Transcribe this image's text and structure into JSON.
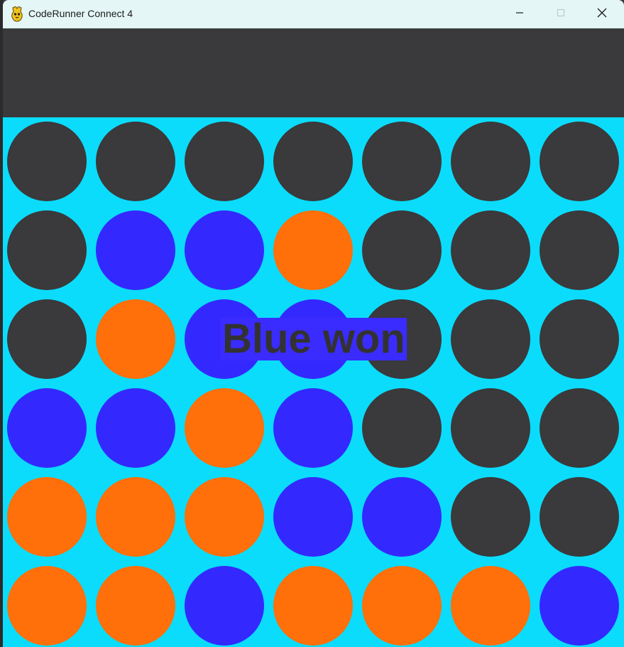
{
  "window": {
    "title": "CodeRunner Connect 4",
    "icon": "python-icon",
    "controls": [
      "minimize-icon",
      "maximize-icon",
      "close-icon"
    ]
  },
  "game": {
    "result_text": "Blue won",
    "rows": 6,
    "columns": 7,
    "grid": [
      [
        "empty",
        "empty",
        "empty",
        "empty",
        "empty",
        "empty",
        "empty"
      ],
      [
        "empty",
        "blue",
        "blue",
        "orange",
        "empty",
        "empty",
        "empty"
      ],
      [
        "empty",
        "orange",
        "blue",
        "blue",
        "empty",
        "empty",
        "empty"
      ],
      [
        "blue",
        "blue",
        "orange",
        "blue",
        "empty",
        "empty",
        "empty"
      ],
      [
        "orange",
        "orange",
        "orange",
        "blue",
        "blue",
        "empty",
        "empty"
      ],
      [
        "orange",
        "orange",
        "blue",
        "orange",
        "orange",
        "orange",
        "blue"
      ]
    ]
  },
  "colors": {
    "board": "#0bdcfc",
    "empty": "#3a393b",
    "blue": "#3329ff",
    "orange": "#ff6f0a",
    "header": "#3a393b",
    "label_bg": "#3a2cff",
    "label_text": "#333232"
  }
}
